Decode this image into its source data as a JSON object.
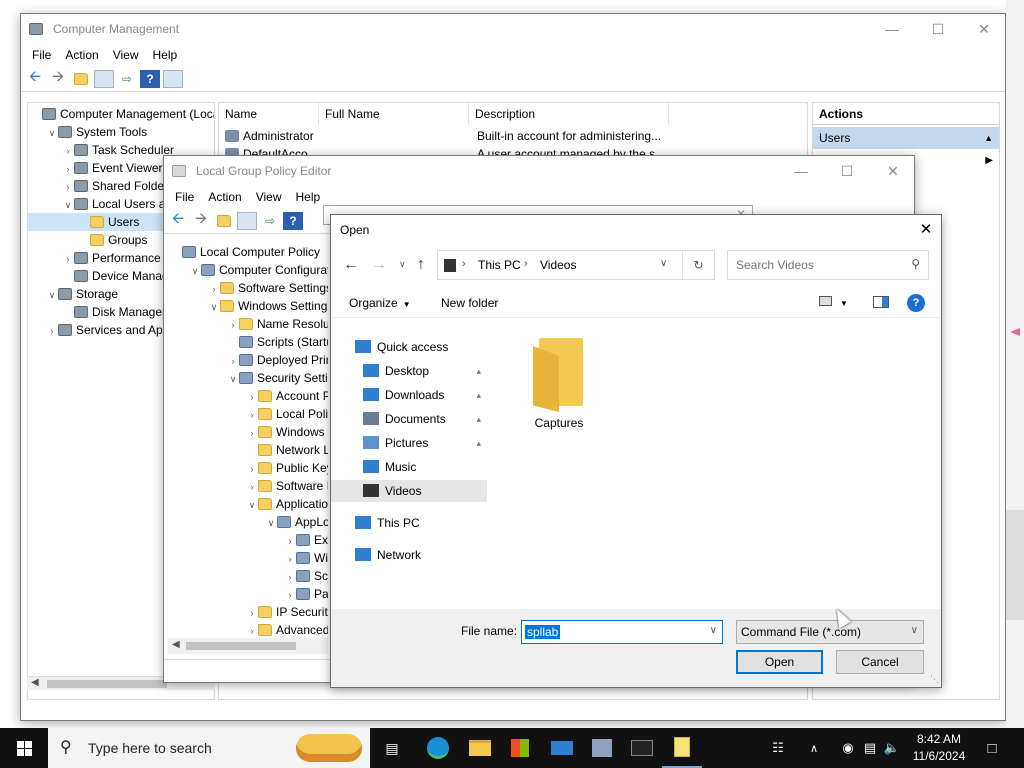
{
  "computer_management": {
    "title": "Computer Management",
    "menu": [
      "File",
      "Action",
      "View",
      "Help"
    ],
    "tree": [
      {
        "label": "Computer Management (Local",
        "expander": "",
        "level": 0
      },
      {
        "label": "System Tools",
        "expander": "v",
        "level": 1
      },
      {
        "label": "Task Scheduler",
        "expander": ">",
        "level": 2
      },
      {
        "label": "Event Viewer",
        "expander": ">",
        "level": 2
      },
      {
        "label": "Shared Folders",
        "expander": ">",
        "level": 2
      },
      {
        "label": "Local Users and Groups",
        "expander": "v",
        "level": 2
      },
      {
        "label": "Users",
        "expander": "",
        "level": 3
      },
      {
        "label": "Groups",
        "expander": "",
        "level": 3
      },
      {
        "label": "Performance",
        "expander": ">",
        "level": 2
      },
      {
        "label": "Device Manager",
        "expander": "",
        "level": 2
      },
      {
        "label": "Storage",
        "expander": "v",
        "level": 1
      },
      {
        "label": "Disk Management",
        "expander": "",
        "level": 2
      },
      {
        "label": "Services and Applications",
        "expander": ">",
        "level": 1
      }
    ],
    "columns": [
      "Name",
      "Full Name",
      "Description"
    ],
    "rows": [
      {
        "name": "Administrator",
        "full_name": "",
        "description": "Built-in account for administering..."
      },
      {
        "name": "DefaultAcco",
        "full_name": "",
        "description": "A user account managed by the s"
      }
    ],
    "actions_header": "Actions",
    "actions_section": "Users"
  },
  "gpedit": {
    "title": "Local Group Policy Editor",
    "menu": [
      "File",
      "Action",
      "View",
      "Help"
    ],
    "tree": [
      {
        "label": "Local Computer Policy",
        "expander": "",
        "level": 0
      },
      {
        "label": "Computer Configuration",
        "expander": "v",
        "level": 1
      },
      {
        "label": "Software Settings",
        "expander": ">",
        "level": 2
      },
      {
        "label": "Windows Settings",
        "expander": "v",
        "level": 2
      },
      {
        "label": "Name Resolution Policy",
        "expander": ">",
        "level": 3
      },
      {
        "label": "Scripts (Startup/Shutdown)",
        "expander": "",
        "level": 3
      },
      {
        "label": "Deployed Printers",
        "expander": ">",
        "level": 3
      },
      {
        "label": "Security Settings",
        "expander": "v",
        "level": 3
      },
      {
        "label": "Account Policies",
        "expander": ">",
        "level": 4
      },
      {
        "label": "Local Policies",
        "expander": ">",
        "level": 4
      },
      {
        "label": "Windows Defender Firewall",
        "expander": ">",
        "level": 4
      },
      {
        "label": "Network List Manager Policies",
        "expander": "",
        "level": 4
      },
      {
        "label": "Public Key Policies",
        "expander": ">",
        "level": 4
      },
      {
        "label": "Software Restriction Policies",
        "expander": ">",
        "level": 4
      },
      {
        "label": "Application Control Policies",
        "expander": "v",
        "level": 4
      },
      {
        "label": "AppLocker",
        "expander": "v",
        "level": 5
      },
      {
        "label": "Executable Rules",
        "expander": ">",
        "level": 6
      },
      {
        "label": "Windows Installer Rules",
        "expander": ">",
        "level": 6
      },
      {
        "label": "Script Rules",
        "expander": ">",
        "level": 6
      },
      {
        "label": "Packaged app Rules",
        "expander": ">",
        "level": 6
      },
      {
        "label": "IP Security Policies",
        "expander": ">",
        "level": 4
      },
      {
        "label": "Advanced Audit Policy",
        "expander": ">",
        "level": 4
      }
    ]
  },
  "open_dialog": {
    "title": "Open",
    "breadcrumb": [
      "This PC",
      "Videos"
    ],
    "search_placeholder": "Search Videos",
    "organize": "Organize",
    "new_folder": "New folder",
    "nav": {
      "quick_access": "Quick access",
      "quick_items": [
        "Desktop",
        "Downloads",
        "Documents",
        "Pictures",
        "Music",
        "Videos"
      ],
      "this_pc": "This PC",
      "network": "Network"
    },
    "folder_item": "Captures",
    "file_name_label": "File name:",
    "file_name_value": "spllab",
    "file_type": "Command File (*.com)",
    "open_button": "Open",
    "cancel_button": "Cancel"
  },
  "taskbar": {
    "search_placeholder": "Type here to search",
    "time": "8:42 AM",
    "date": "11/6/2024"
  }
}
